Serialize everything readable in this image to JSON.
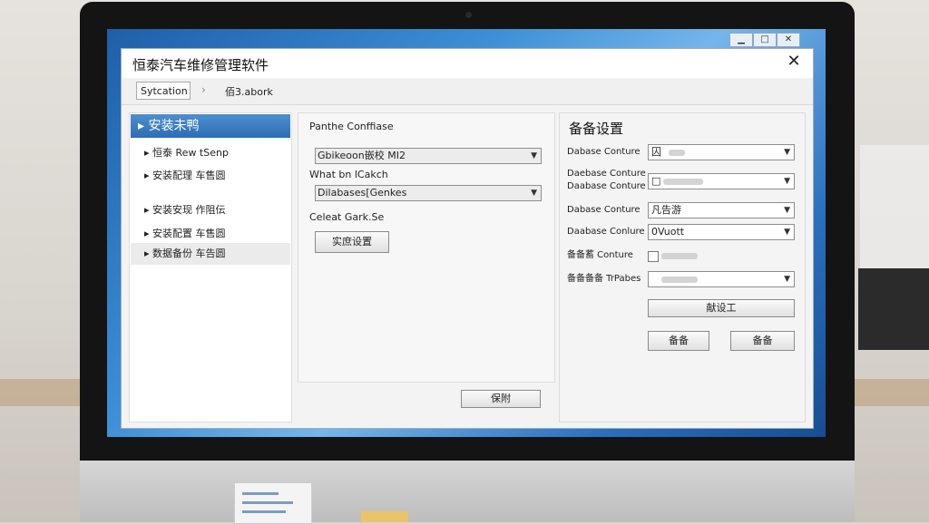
{
  "window": {
    "minimize": "▁",
    "maximize": "□",
    "close": "✕"
  },
  "app": {
    "title": "恒泰汽车维修管理软件",
    "close_label": "✕",
    "breadcrumb": {
      "first": "Sytcation",
      "separator": "›",
      "second": "佰3.abork"
    }
  },
  "nav": {
    "header": "安装未鸭",
    "items": [
      {
        "label": "恒泰 Rew tSenp"
      },
      {
        "label": "安装配理 车售圆"
      },
      {
        "label": "安装安现 作阻伝"
      },
      {
        "label": "安装配置 车售圆"
      },
      {
        "label": "数据备份 车告圆"
      }
    ]
  },
  "middle": {
    "heading": "Panthe Conffiase",
    "combo1_value": "Gbikeoon嵌校 MI2",
    "label2": "What bn lCakch",
    "combo2_value": "Dilabases[Genkes",
    "label3": "Celeat Gark.Se",
    "action_button": "实庶设置",
    "footer_button": "保附"
  },
  "right": {
    "heading": "备备设置",
    "rows": [
      {
        "label": "Dabase Conture",
        "value": "囚",
        "type": "select"
      },
      {
        "label": "Daebase Conture\nDaabase Conture",
        "value": "□",
        "type": "select"
      },
      {
        "label": "Dabase Conture",
        "value": "凡告游",
        "type": "input"
      },
      {
        "label": "Daabase Conlure",
        "value": "0Vuott",
        "type": "select"
      },
      {
        "label": "备备蓄 Conture",
        "value": "",
        "type": "checkbox"
      },
      {
        "label": "备备备备 TrPabes",
        "value": "",
        "type": "select"
      }
    ],
    "wide_button": "献设工",
    "button_left": "备备",
    "button_right": "备备"
  },
  "icons": {
    "nav_bullet": "▸",
    "dropdown": "▼"
  }
}
